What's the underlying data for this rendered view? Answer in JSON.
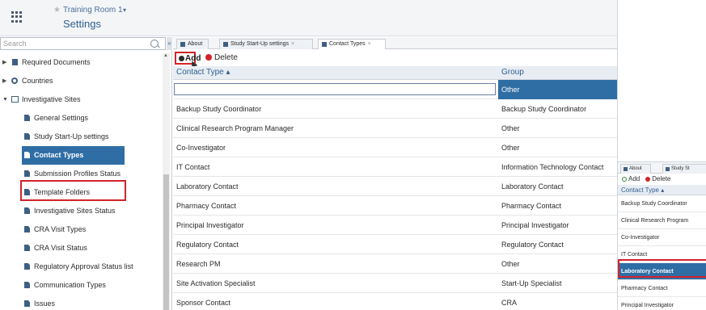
{
  "header": {
    "room_name": "Training Room 1",
    "room_caret": "▾",
    "title": "Settings"
  },
  "sidebar": {
    "search_placeholder": "Search",
    "collapse_glyph": "«",
    "items": [
      {
        "label": "Required Documents",
        "icon": "document-icon",
        "level": 0,
        "expand": "▶"
      },
      {
        "label": "Countries",
        "icon": "globe-icon",
        "level": 0,
        "expand": "▶"
      },
      {
        "label": "Investigative Sites",
        "icon": "sites-icon",
        "level": 0,
        "expand": "▼"
      },
      {
        "label": "General Settings",
        "icon": "page-icon",
        "level": 1
      },
      {
        "label": "Study Start-Up settings",
        "icon": "page-icon",
        "level": 1
      },
      {
        "label": "Contact Types",
        "icon": "page-icon",
        "level": 1,
        "active": true
      },
      {
        "label": "Submission Profiles Status",
        "icon": "page-icon",
        "level": 1
      },
      {
        "label": "Template Folders",
        "icon": "page-icon",
        "level": 1
      },
      {
        "label": "Investigative Sites Status",
        "icon": "page-icon",
        "level": 1
      },
      {
        "label": "CRA Visit Types",
        "icon": "page-icon",
        "level": 1
      },
      {
        "label": "CRA Visit Status",
        "icon": "page-icon",
        "level": 1
      },
      {
        "label": "Regulatory Approval Status list",
        "icon": "page-icon",
        "level": 1
      },
      {
        "label": "Communication Types",
        "icon": "page-icon",
        "level": 1
      },
      {
        "label": "Issues",
        "icon": "page-icon",
        "level": 1
      }
    ]
  },
  "tabs": [
    {
      "label": "About",
      "closable": false
    },
    {
      "label": "Study Start-Up settings",
      "closable": true
    },
    {
      "label": "Contact Types",
      "closable": true,
      "active": true
    }
  ],
  "toolbar": {
    "add_label": "Add",
    "delete_label": "Delete"
  },
  "grid": {
    "col_contact_type": "Contact Type ▴",
    "col_group": "Group",
    "new_row_group": "Other",
    "rows": [
      {
        "type": "Backup Study Coordinator",
        "group": "Backup Study Coordinator"
      },
      {
        "type": "Clinical Research Program Manager",
        "group": "Other"
      },
      {
        "type": "Co-Investigator",
        "group": "Other"
      },
      {
        "type": "IT Contact",
        "group": "Information Technology Contact"
      },
      {
        "type": "Laboratory Contact",
        "group": "Laboratory Contact"
      },
      {
        "type": "Pharmacy Contact",
        "group": "Pharmacy Contact"
      },
      {
        "type": "Principal Investigator",
        "group": "Principal Investigator"
      },
      {
        "type": "Regulatory Contact",
        "group": "Regulatory Contact"
      },
      {
        "type": "Research PM",
        "group": "Other"
      },
      {
        "type": "Site Activation Specialist",
        "group": "Start-Up Specialist"
      },
      {
        "type": "Sponsor Contact",
        "group": "CRA"
      }
    ]
  },
  "inset": {
    "tab1": "About",
    "tab2": "Study St",
    "add_label": "Add",
    "delete_label": "Delete",
    "col_header": "Contact Type ▴",
    "rows": [
      "Backup Study Coordinator",
      "Clinical Research Program",
      "Co-Investigator",
      "IT Contact",
      "Laboratory Contact",
      "Pharmacy Contact",
      "Principal Investigator"
    ],
    "selected_row": "Laboratory Contact"
  },
  "colors": {
    "accent": "#2f6ea5",
    "highlight_border": "#d2232a",
    "link": "#2f5e8f"
  }
}
